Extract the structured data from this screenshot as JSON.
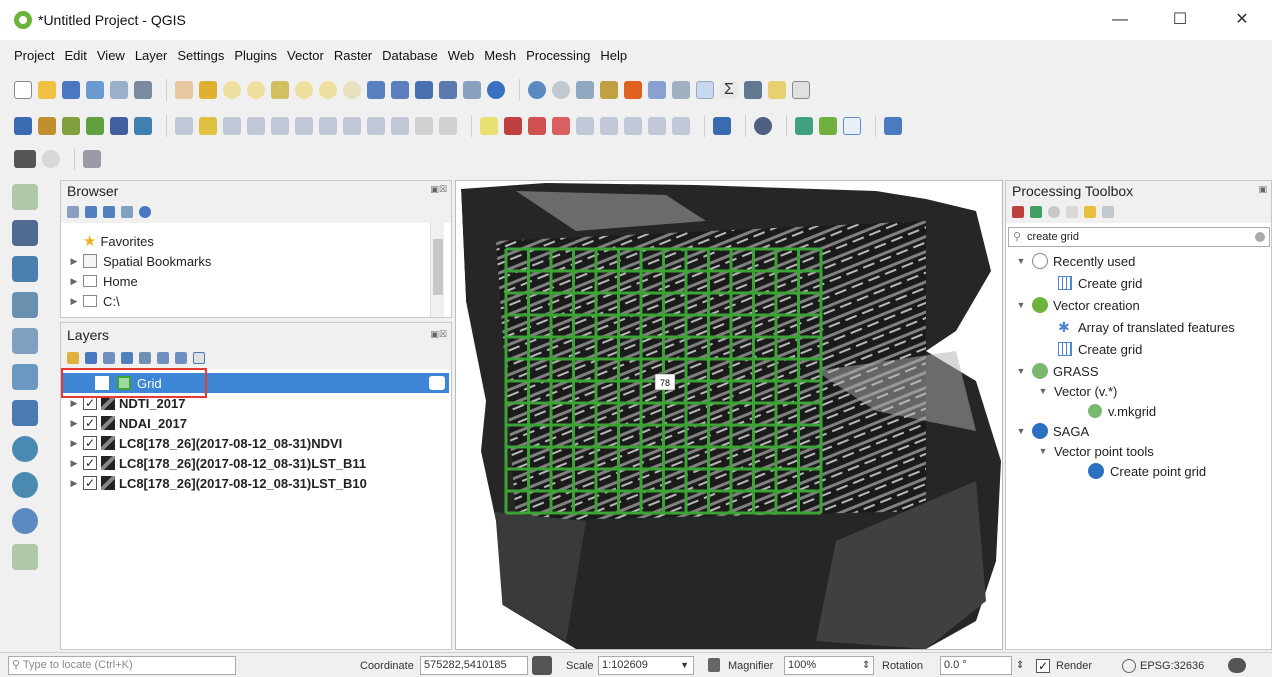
{
  "window": {
    "title": "*Untitled Project - QGIS"
  },
  "menu": [
    "Project",
    "Edit",
    "View",
    "Layer",
    "Settings",
    "Plugins",
    "Vector",
    "Raster",
    "Database",
    "Web",
    "Mesh",
    "Processing",
    "Help"
  ],
  "browser": {
    "title": "Browser",
    "items": [
      {
        "label": "Favorites",
        "icon": "star-icon"
      },
      {
        "label": "Spatial Bookmarks",
        "icon": "bookmark-icon"
      },
      {
        "label": "Home",
        "icon": "home-folder-icon"
      },
      {
        "label": "C:\\",
        "icon": "drive-folder-icon"
      }
    ]
  },
  "layers": {
    "title": "Layers",
    "items": [
      {
        "label": "Grid",
        "checked": true,
        "selected": true
      },
      {
        "label": "NDTI_2017",
        "checked": true
      },
      {
        "label": "NDAI_2017",
        "checked": true
      },
      {
        "label": "LC8[178_26](2017-08-12_08-31)NDVI",
        "checked": true
      },
      {
        "label": "LC8[178_26](2017-08-12_08-31)LST_B11",
        "checked": true
      },
      {
        "label": "LC8[178_26](2017-08-12_08-31)LST_B10",
        "checked": true
      }
    ]
  },
  "map": {
    "grid_label": "78",
    "grid_color": "#3aa535",
    "selection_color": "#e53935"
  },
  "toolbox": {
    "title": "Processing Toolbox",
    "search_value": "create grid",
    "tree": [
      {
        "label": "Recently used",
        "level": 0
      },
      {
        "label": "Create grid",
        "level": 1
      },
      {
        "label": "Vector creation",
        "level": 0
      },
      {
        "label": "Array of translated features",
        "level": 1
      },
      {
        "label": "Create grid",
        "level": 1
      },
      {
        "label": "GRASS",
        "level": 0
      },
      {
        "label": "Vector (v.*)",
        "level": 1
      },
      {
        "label": "v.mkgrid",
        "level": 2
      },
      {
        "label": "SAGA",
        "level": 0
      },
      {
        "label": "Vector point tools",
        "level": 1
      },
      {
        "label": "Create point grid",
        "level": 2
      }
    ]
  },
  "status": {
    "locate_placeholder": "Type to locate (Ctrl+K)",
    "coordinate_label": "Coordinate",
    "coordinate_value": "575282,5410185",
    "scale_label": "Scale",
    "scale_value": "1:102609",
    "magnifier_label": "Magnifier",
    "magnifier_value": "100%",
    "rotation_label": "Rotation",
    "rotation_value": "0.0 °",
    "render_label": "Render",
    "crs": "EPSG:32636"
  }
}
